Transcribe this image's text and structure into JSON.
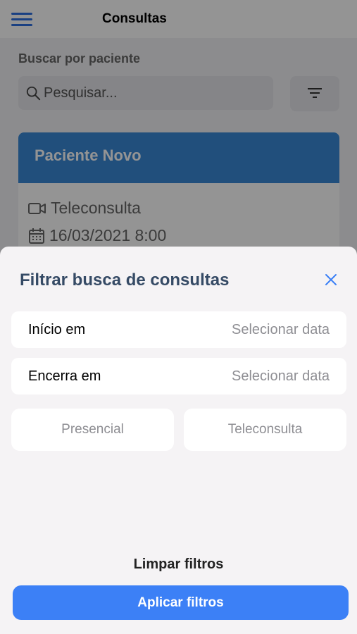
{
  "header": {
    "title": "Consultas",
    "menu_icon": "hamburger-menu-icon"
  },
  "search": {
    "label": "Buscar por paciente",
    "placeholder": "Pesquisar...",
    "value": "",
    "icon": "search-icon",
    "filter_icon": "filter-icon"
  },
  "consultation_card": {
    "patient": "Paciente Novo",
    "type": "Teleconsulta",
    "datetime": "16/03/2021 8:00",
    "type_icon": "video-camera-icon",
    "date_icon": "calendar-icon",
    "header_color": "#3a88d6"
  },
  "filter_sheet": {
    "title": "Filtrar busca de consultas",
    "close_icon": "close-icon",
    "start": {
      "label": "Início em",
      "value": "Selecionar data"
    },
    "end": {
      "label": "Encerra em",
      "value": "Selecionar data"
    },
    "options": [
      "Presencial",
      "Teleconsulta"
    ],
    "clear_label": "Limpar filtros",
    "apply_label": "Aplicar filtros",
    "apply_color": "#3c80f6"
  }
}
